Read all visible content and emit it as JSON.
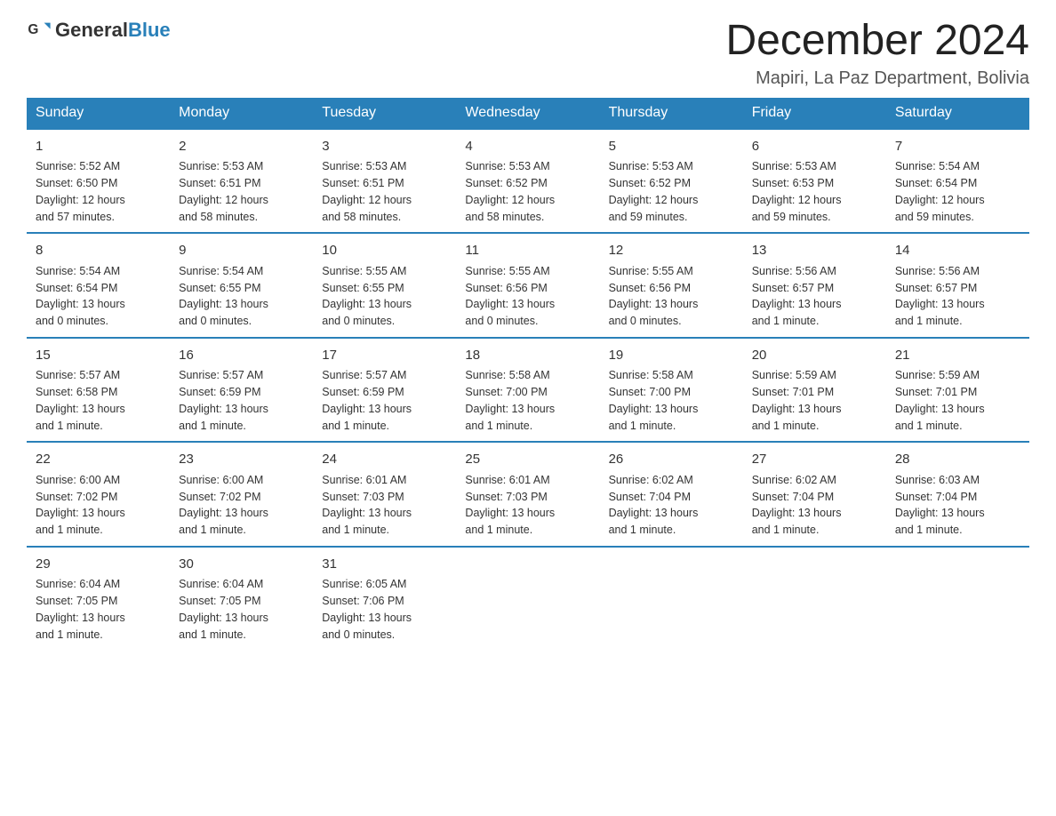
{
  "header": {
    "logo_general": "General",
    "logo_blue": "Blue",
    "month_title": "December 2024",
    "location": "Mapiri, La Paz Department, Bolivia"
  },
  "days_of_week": [
    "Sunday",
    "Monday",
    "Tuesday",
    "Wednesday",
    "Thursday",
    "Friday",
    "Saturday"
  ],
  "weeks": [
    [
      {
        "day": "1",
        "info": "Sunrise: 5:52 AM\nSunset: 6:50 PM\nDaylight: 12 hours\nand 57 minutes."
      },
      {
        "day": "2",
        "info": "Sunrise: 5:53 AM\nSunset: 6:51 PM\nDaylight: 12 hours\nand 58 minutes."
      },
      {
        "day": "3",
        "info": "Sunrise: 5:53 AM\nSunset: 6:51 PM\nDaylight: 12 hours\nand 58 minutes."
      },
      {
        "day": "4",
        "info": "Sunrise: 5:53 AM\nSunset: 6:52 PM\nDaylight: 12 hours\nand 58 minutes."
      },
      {
        "day": "5",
        "info": "Sunrise: 5:53 AM\nSunset: 6:52 PM\nDaylight: 12 hours\nand 59 minutes."
      },
      {
        "day": "6",
        "info": "Sunrise: 5:53 AM\nSunset: 6:53 PM\nDaylight: 12 hours\nand 59 minutes."
      },
      {
        "day": "7",
        "info": "Sunrise: 5:54 AM\nSunset: 6:54 PM\nDaylight: 12 hours\nand 59 minutes."
      }
    ],
    [
      {
        "day": "8",
        "info": "Sunrise: 5:54 AM\nSunset: 6:54 PM\nDaylight: 13 hours\nand 0 minutes."
      },
      {
        "day": "9",
        "info": "Sunrise: 5:54 AM\nSunset: 6:55 PM\nDaylight: 13 hours\nand 0 minutes."
      },
      {
        "day": "10",
        "info": "Sunrise: 5:55 AM\nSunset: 6:55 PM\nDaylight: 13 hours\nand 0 minutes."
      },
      {
        "day": "11",
        "info": "Sunrise: 5:55 AM\nSunset: 6:56 PM\nDaylight: 13 hours\nand 0 minutes."
      },
      {
        "day": "12",
        "info": "Sunrise: 5:55 AM\nSunset: 6:56 PM\nDaylight: 13 hours\nand 0 minutes."
      },
      {
        "day": "13",
        "info": "Sunrise: 5:56 AM\nSunset: 6:57 PM\nDaylight: 13 hours\nand 1 minute."
      },
      {
        "day": "14",
        "info": "Sunrise: 5:56 AM\nSunset: 6:57 PM\nDaylight: 13 hours\nand 1 minute."
      }
    ],
    [
      {
        "day": "15",
        "info": "Sunrise: 5:57 AM\nSunset: 6:58 PM\nDaylight: 13 hours\nand 1 minute."
      },
      {
        "day": "16",
        "info": "Sunrise: 5:57 AM\nSunset: 6:59 PM\nDaylight: 13 hours\nand 1 minute."
      },
      {
        "day": "17",
        "info": "Sunrise: 5:57 AM\nSunset: 6:59 PM\nDaylight: 13 hours\nand 1 minute."
      },
      {
        "day": "18",
        "info": "Sunrise: 5:58 AM\nSunset: 7:00 PM\nDaylight: 13 hours\nand 1 minute."
      },
      {
        "day": "19",
        "info": "Sunrise: 5:58 AM\nSunset: 7:00 PM\nDaylight: 13 hours\nand 1 minute."
      },
      {
        "day": "20",
        "info": "Sunrise: 5:59 AM\nSunset: 7:01 PM\nDaylight: 13 hours\nand 1 minute."
      },
      {
        "day": "21",
        "info": "Sunrise: 5:59 AM\nSunset: 7:01 PM\nDaylight: 13 hours\nand 1 minute."
      }
    ],
    [
      {
        "day": "22",
        "info": "Sunrise: 6:00 AM\nSunset: 7:02 PM\nDaylight: 13 hours\nand 1 minute."
      },
      {
        "day": "23",
        "info": "Sunrise: 6:00 AM\nSunset: 7:02 PM\nDaylight: 13 hours\nand 1 minute."
      },
      {
        "day": "24",
        "info": "Sunrise: 6:01 AM\nSunset: 7:03 PM\nDaylight: 13 hours\nand 1 minute."
      },
      {
        "day": "25",
        "info": "Sunrise: 6:01 AM\nSunset: 7:03 PM\nDaylight: 13 hours\nand 1 minute."
      },
      {
        "day": "26",
        "info": "Sunrise: 6:02 AM\nSunset: 7:04 PM\nDaylight: 13 hours\nand 1 minute."
      },
      {
        "day": "27",
        "info": "Sunrise: 6:02 AM\nSunset: 7:04 PM\nDaylight: 13 hours\nand 1 minute."
      },
      {
        "day": "28",
        "info": "Sunrise: 6:03 AM\nSunset: 7:04 PM\nDaylight: 13 hours\nand 1 minute."
      }
    ],
    [
      {
        "day": "29",
        "info": "Sunrise: 6:04 AM\nSunset: 7:05 PM\nDaylight: 13 hours\nand 1 minute."
      },
      {
        "day": "30",
        "info": "Sunrise: 6:04 AM\nSunset: 7:05 PM\nDaylight: 13 hours\nand 1 minute."
      },
      {
        "day": "31",
        "info": "Sunrise: 6:05 AM\nSunset: 7:06 PM\nDaylight: 13 hours\nand 0 minutes."
      },
      {
        "day": "",
        "info": ""
      },
      {
        "day": "",
        "info": ""
      },
      {
        "day": "",
        "info": ""
      },
      {
        "day": "",
        "info": ""
      }
    ]
  ]
}
